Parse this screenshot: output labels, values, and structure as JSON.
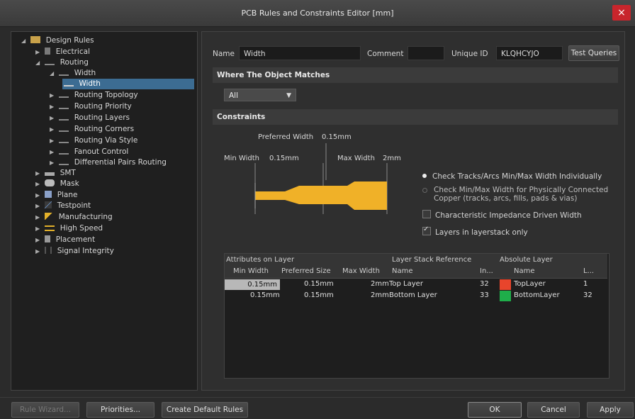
{
  "window": {
    "title": "PCB Rules and Constraints Editor [mm]",
    "close_glyph": "×"
  },
  "tree": {
    "root": "Design Rules",
    "items": [
      {
        "label": "Electrical",
        "icon": "electrical-icon"
      },
      {
        "label": "Routing",
        "icon": "routing-icon"
      },
      {
        "label": "Width",
        "icon": "width-rule-icon"
      },
      {
        "label": "Width",
        "icon": "width-rule-icon"
      },
      {
        "label": "Routing Topology",
        "icon": "routing-icon"
      },
      {
        "label": "Routing Priority",
        "icon": "routing-icon"
      },
      {
        "label": "Routing Layers",
        "icon": "routing-icon"
      },
      {
        "label": "Routing Corners",
        "icon": "routing-icon"
      },
      {
        "label": "Routing Via Style",
        "icon": "routing-icon"
      },
      {
        "label": "Fanout Control",
        "icon": "routing-icon"
      },
      {
        "label": "Differential Pairs Routing",
        "icon": "routing-icon"
      },
      {
        "label": "SMT",
        "icon": "smt-icon"
      },
      {
        "label": "Mask",
        "icon": "mask-icon"
      },
      {
        "label": "Plane",
        "icon": "plane-icon"
      },
      {
        "label": "Testpoint",
        "icon": "testpoint-icon"
      },
      {
        "label": "Manufacturing",
        "icon": "manufacturing-icon"
      },
      {
        "label": "High Speed",
        "icon": "high-speed-icon"
      },
      {
        "label": "Placement",
        "icon": "placement-icon"
      },
      {
        "label": "Signal Integrity",
        "icon": "signal-integrity-icon"
      }
    ]
  },
  "rule": {
    "name_label": "Name",
    "name_value": "Width",
    "comment_label": "Comment",
    "comment_value": "",
    "uid_label": "Unique ID",
    "uid_value": "KLQHCYJO",
    "test_queries": "Test Queries"
  },
  "where": {
    "heading": "Where The Object Matches",
    "selected": "All"
  },
  "constraints": {
    "heading": "Constraints",
    "preferred_label": "Preferred Width",
    "preferred_value": "0.15mm",
    "min_label": "Min Width",
    "min_value": "0.15mm",
    "max_label": "Max Width",
    "max_value": "2mm",
    "options": {
      "check_individually": "Check Tracks/Arcs Min/Max Width Individually",
      "check_connected": "Check Min/Max Width for Physically Connected Copper (tracks, arcs, fills, pads & vias)",
      "impedance": "Characteristic Impedance Driven Width",
      "layers_only": "Layers in layerstack only"
    },
    "trace_color": "#f0b128"
  },
  "table": {
    "group_headers": [
      "Attributes on Layer",
      "Layer Stack Reference",
      "Absolute Layer"
    ],
    "columns": [
      "Min Width",
      "Preferred Size",
      "Max Width",
      "Name",
      "In...",
      "Name",
      "L..."
    ],
    "rows": [
      {
        "min": "0.15mm",
        "pref": "0.15mm",
        "max": "2mm",
        "name": "Top Layer",
        "index": "32",
        "abs_name": "TopLayer",
        "abs_color": "#e8452c",
        "layer_num": "1"
      },
      {
        "min": "0.15mm",
        "pref": "0.15mm",
        "max": "2mm",
        "name": "Bottom Layer",
        "index": "33",
        "abs_name": "BottomLayer",
        "abs_color": "#1fae4a",
        "layer_num": "32"
      }
    ]
  },
  "footer": {
    "rule_wizard": "Rule Wizard...",
    "priorities": "Priorities...",
    "create_default": "Create Default Rules",
    "ok": "OK",
    "cancel": "Cancel",
    "apply": "Apply"
  }
}
